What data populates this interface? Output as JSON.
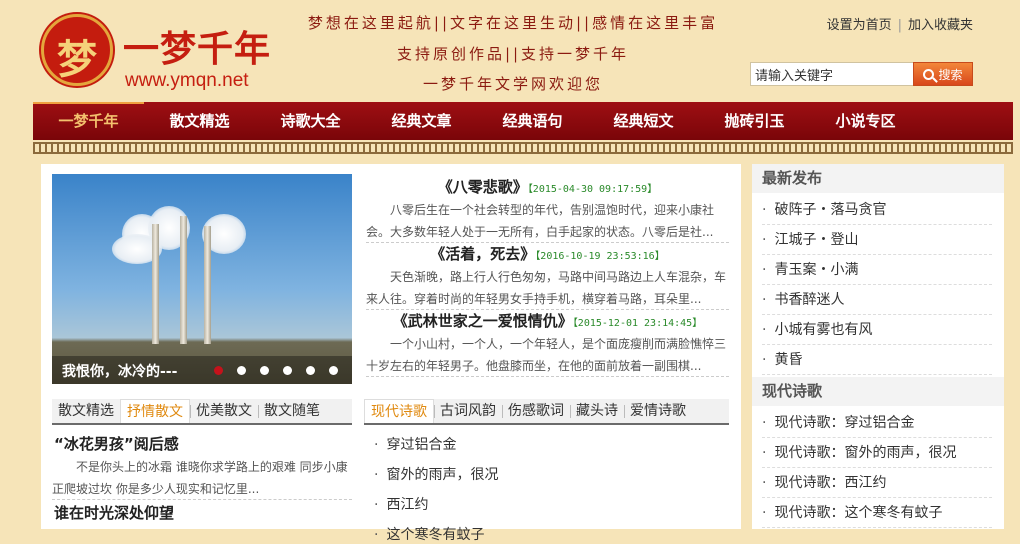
{
  "logo": {
    "glyph": "梦",
    "title": "一梦千年",
    "url": "www.ymqn.net"
  },
  "slogan": {
    "line1": "梦想在这里起航||文字在这里生动||感情在这里丰富",
    "line2": "支持原创作品||支持一梦千年",
    "line3": "一梦千年文学网欢迎您"
  },
  "toplinks": {
    "home": "设置为首页",
    "favorite": "加入收藏夹"
  },
  "search": {
    "placeholder": "请输入关键字",
    "button": "搜索"
  },
  "nav": [
    "一梦千年",
    "散文精选",
    "诗歌大全",
    "经典文章",
    "经典语句",
    "经典短文",
    "抛砖引玉",
    "小说专区"
  ],
  "slider": {
    "caption": "我恨你，冰冷的---",
    "dots": 6,
    "active_dot": 0
  },
  "articles": [
    {
      "title": "《八零悲歌》",
      "date": "【2015-04-30 09:17:59】",
      "body": "八零后生在一个社会转型的年代，告别温饱时代，迎来小康社会。大多数年轻人处于一无所有，白手起家的状态。八零后是社..."
    },
    {
      "title": "《活着，死去》",
      "date": "【2016-10-19 23:53:16】",
      "body": "天色渐晚，路上行人行色匆匆，马路中间马路边上人车混杂，车来人往。穿着时尚的年轻男女手持手机，横穿着马路，耳朵里..."
    },
    {
      "title": "《武林世家之一爱恨情仇》",
      "date": "【2015-12-01 23:14:45】",
      "body": "一个小山村，一个人，一个年轻人，是个面庞瘦削而满脸憔悴三十岁左右的年轻男子。他盘膝而坐，在他的面前放着一副围棋..."
    }
  ],
  "prose": {
    "tabs": [
      "散文精选",
      "抒情散文",
      "优美散文",
      "散文随笔"
    ],
    "active_tab": 1,
    "featured_title": "“冰花男孩”阅后感",
    "featured_body": "不是你头上的冰霜 谁晓你求学路上的艰难 同步小康正爬坡过坎 你是多少人现实和记忆里...",
    "second_title": "谁在时光深处仰望"
  },
  "poetry": {
    "tabs": [
      "现代诗歌",
      "古词风韵",
      "伤感歌词",
      "藏头诗",
      "爱情诗歌"
    ],
    "active_tab": 0,
    "items": [
      "穿过铝合金",
      "窗外的雨声，很况",
      "西江约",
      "这个寒冬有蚊子"
    ]
  },
  "sidebar": {
    "latest_title": "最新发布",
    "latest": [
      "破阵子・落马贪官",
      "江城子・登山",
      "青玉案・小满",
      "书香醉迷人",
      "小城有雾也有风",
      "黄昏"
    ],
    "poetry_title": "现代诗歌",
    "poetry": [
      "现代诗歌：穿过铝合金",
      "现代诗歌：窗外的雨声，很况",
      "现代诗歌：西江约",
      "现代诗歌：这个寒冬有蚊子"
    ]
  }
}
